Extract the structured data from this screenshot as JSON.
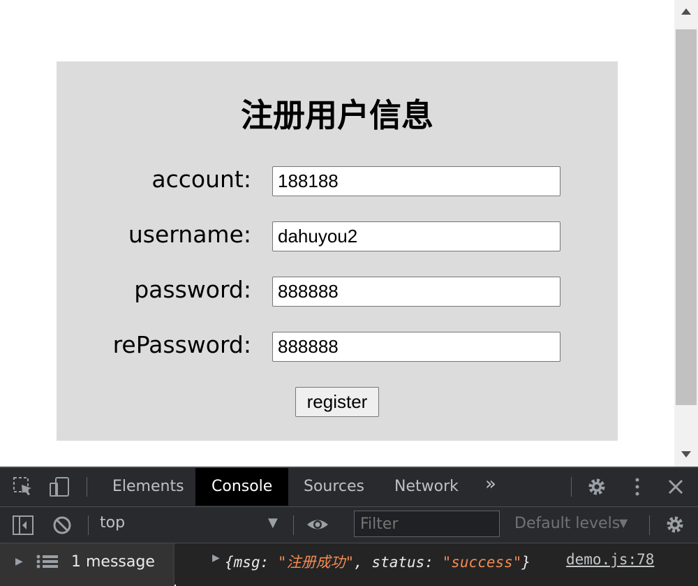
{
  "form": {
    "title": "注册用户信息",
    "fields": [
      {
        "label": "account:",
        "value": "188188"
      },
      {
        "label": "username:",
        "value": "dahuyou2"
      },
      {
        "label": "password:",
        "value": "888888"
      },
      {
        "label": "rePassword:",
        "value": "888888"
      }
    ],
    "register_label": "register"
  },
  "devtools": {
    "tabs": [
      "Elements",
      "Console",
      "Sources",
      "Network"
    ],
    "active_tab": "Console",
    "more_tabs_glyph": "»",
    "context": "top",
    "filter_placeholder": "Filter",
    "levels": "Default levels",
    "sidebar_summary": "1 message",
    "log": {
      "open": "{",
      "key1": "msg: ",
      "val1": "\"注册成功\"",
      "mid": ", ",
      "key2": "status: ",
      "val2": "\"success\"",
      "close": "}",
      "source": "demo.js:78"
    },
    "colors": {
      "string": "#f28b54",
      "key": "#e8eaed",
      "active_tab_bg": "#000000"
    },
    "icons": [
      "inspect-element-icon",
      "device-toolbar-icon",
      "settings-gear-icon",
      "kebab-menu-icon",
      "close-icon",
      "sidebar-toggle-icon",
      "clear-console-icon",
      "eye-icon",
      "list-icon",
      "expand-triangle-icon"
    ]
  }
}
